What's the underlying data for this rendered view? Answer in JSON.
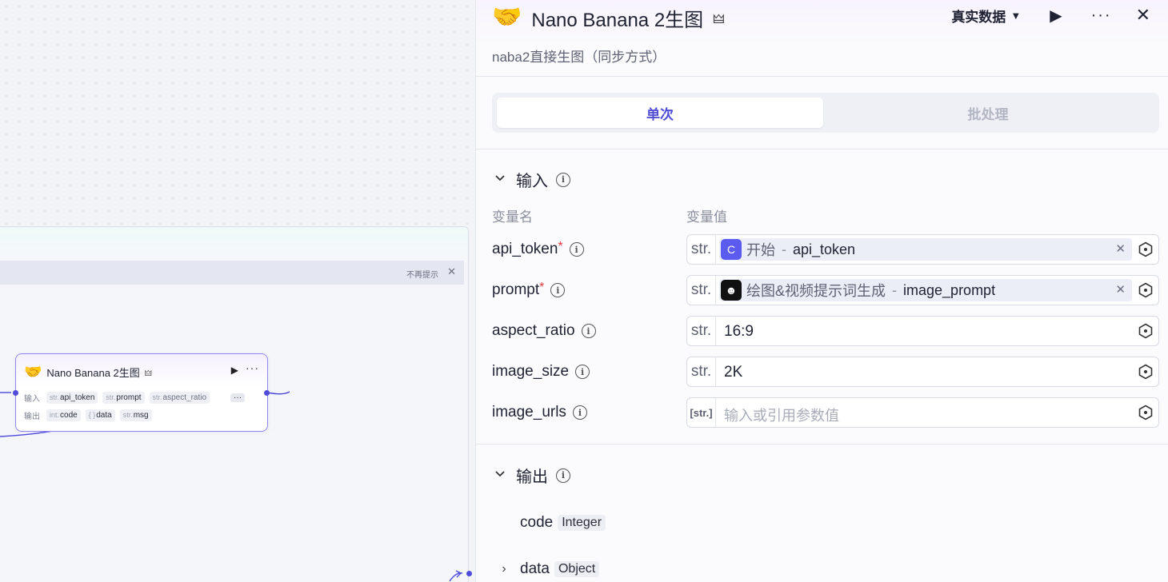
{
  "canvas": {
    "hint": {
      "text": "不再提示",
      "close": "✕"
    },
    "node": {
      "emoji": "🤝",
      "title": "Nano Banana 2生图",
      "badge": "🜲",
      "run": "▶",
      "more": "···",
      "input_label": "输入",
      "output_label": "输出",
      "inputs": [
        {
          "type": "str.",
          "name": "api_token"
        },
        {
          "type": "str.",
          "name": "prompt"
        },
        {
          "type": "str.",
          "name": "aspect_ratio"
        }
      ],
      "inputs_more": "···",
      "outputs": [
        {
          "type": "int.",
          "name": "code"
        },
        {
          "type": "{ }",
          "name": "data"
        },
        {
          "type": "str.",
          "name": "msg"
        }
      ]
    }
  },
  "panel": {
    "header": {
      "emoji": "🤝",
      "title": "Nano Banana 2生图",
      "badge": "🜲",
      "mode": "真实数据",
      "mode_caret": "▼",
      "run": "▶",
      "more": "···",
      "close": "✕"
    },
    "subtitle": "naba2直接生图（同步方式）",
    "tabs": {
      "single": "单次",
      "batch": "批处理"
    },
    "input_section": {
      "chevron": "⌄",
      "title": "输入",
      "col_name": "变量名",
      "col_value": "变量值",
      "rows": [
        {
          "name": "api_token",
          "required": "*",
          "type": "str.",
          "ref_icon": "C",
          "ref_source": "开始",
          "ref_sep": "-",
          "ref_var": "api_token",
          "clear": "✕"
        },
        {
          "name": "prompt",
          "required": "*",
          "type": "str.",
          "ref_icon": "☻",
          "ref_source": "绘图&视频提示词生成",
          "ref_sep": "-",
          "ref_var": "image_prompt",
          "clear": "✕"
        },
        {
          "name": "aspect_ratio",
          "type": "str.",
          "value": "16:9"
        },
        {
          "name": "image_size",
          "type": "str.",
          "value": "2K"
        },
        {
          "name": "image_urls",
          "type": "[str.]",
          "placeholder": "输入或引用参数值"
        }
      ]
    },
    "output_section": {
      "chevron": "⌄",
      "title": "输出",
      "rows": [
        {
          "name": "code",
          "type": "Integer"
        },
        {
          "name": "data",
          "type": "Object",
          "chevron": "›"
        }
      ]
    },
    "info_glyph": "i"
  }
}
